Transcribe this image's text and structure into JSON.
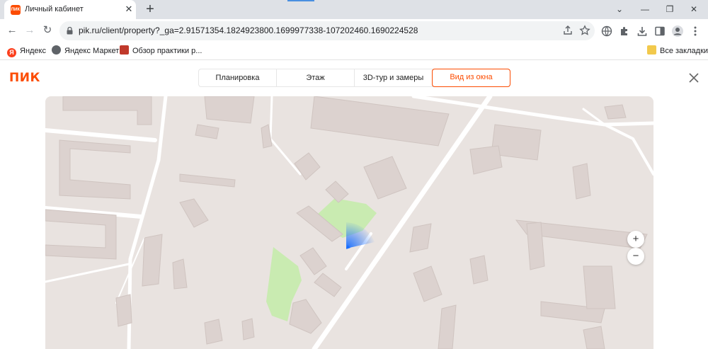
{
  "browser": {
    "tab": {
      "title": "Личный кабинет",
      "favicon_text": "ПИК",
      "close": "✕"
    },
    "new_tab": "+",
    "window": {
      "dropdown": "⌄",
      "minimize": "—",
      "restore": "❐",
      "close": "✕"
    },
    "nav": {
      "back": "←",
      "forward": "→",
      "reload": "↻"
    },
    "url": "pik.ru/client/property?_ga=2.91571354.1824923800.1699977338-107202460.1690224528",
    "bookmarks": [
      {
        "label": "Яндекс",
        "icon": "yandex-icon",
        "color": "#fc3f1d"
      },
      {
        "label": "Яндекс Маркет",
        "icon": "globe-icon",
        "color": "#5f6368"
      },
      {
        "label": "Обзор практики р...",
        "icon": "site-icon",
        "color": "#c0392b"
      }
    ],
    "all_bookmarks": "Все закладки"
  },
  "page": {
    "logo": "ПИК",
    "tabs": [
      {
        "label": "Планировка",
        "active": false
      },
      {
        "label": "Этаж",
        "active": false
      },
      {
        "label": "3D-тур и замеры",
        "active": false
      },
      {
        "label": "Вид из окна",
        "active": true
      }
    ],
    "accent_color": "#fc4c02"
  },
  "map": {
    "zoom_in": "+",
    "zoom_out": "−",
    "view_cone_color": "#1a6fff"
  }
}
